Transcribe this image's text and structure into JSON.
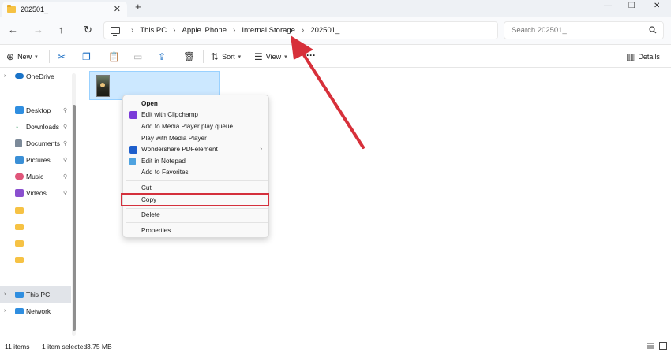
{
  "tab": {
    "title": "202501_",
    "close": "✕",
    "new": "+"
  },
  "window": {
    "minimize": "—",
    "maximize": "❐",
    "close": "✕"
  },
  "nav": {
    "back": "←",
    "forward": "→",
    "up": "↑",
    "refresh": "↻"
  },
  "breadcrumb": {
    "separator": "›",
    "items": [
      "This PC",
      "Apple iPhone",
      "Internal Storage",
      "202501_"
    ]
  },
  "search": {
    "placeholder": "Search 202501_"
  },
  "toolbar": {
    "new_label": "New",
    "sort_label": "Sort",
    "view_label": "View",
    "details_label": "Details",
    "more": "···"
  },
  "sidebar": {
    "items": [
      {
        "label": "OneDrive",
        "expander": "›",
        "icon": "cloud-icon"
      },
      {
        "label": "Desktop",
        "pin": "📌",
        "icon": "desktop-icon"
      },
      {
        "label": "Downloads",
        "pin": "📌",
        "icon": "download-icon"
      },
      {
        "label": "Documents",
        "pin": "📌",
        "icon": "document-icon"
      },
      {
        "label": "Pictures",
        "pin": "📌",
        "icon": "pictures-icon"
      },
      {
        "label": "Music",
        "pin": "📌",
        "icon": "music-icon"
      },
      {
        "label": "Videos",
        "pin": "📌",
        "icon": "video-icon"
      },
      {
        "label": "",
        "icon": "folder-icon"
      },
      {
        "label": "",
        "icon": "folder-icon"
      },
      {
        "label": "",
        "icon": "folder-icon"
      },
      {
        "label": "",
        "icon": "folder-icon"
      },
      {
        "label": "This PC",
        "expander": "›",
        "icon": "this-pc-icon",
        "selected": true
      },
      {
        "label": "Network",
        "expander": "›",
        "icon": "network-icon"
      }
    ]
  },
  "context_menu": {
    "items": [
      {
        "label": "Open",
        "bold": true
      },
      {
        "label": "Edit with Clipchamp",
        "icon": "clipchamp-icon"
      },
      {
        "label": "Add to Media Player play queue"
      },
      {
        "label": "Play with Media Player"
      },
      {
        "label": "Wondershare PDFelement",
        "icon": "pdfelement-icon",
        "submenu": "›"
      },
      {
        "label": "Edit in Notepad",
        "icon": "notepad-icon"
      },
      {
        "label": "Add to Favorites"
      },
      {
        "label": "Cut"
      },
      {
        "label": "Copy",
        "highlighted": true
      },
      {
        "label": "Delete"
      },
      {
        "label": "Properties"
      }
    ]
  },
  "status": {
    "items_count": "11 items",
    "selection": "1 item selected",
    "size": "3.75 MB"
  },
  "colors": {
    "highlight": "#d4303c",
    "selection": "#cce8ff",
    "accent": "#1a6ec4"
  }
}
